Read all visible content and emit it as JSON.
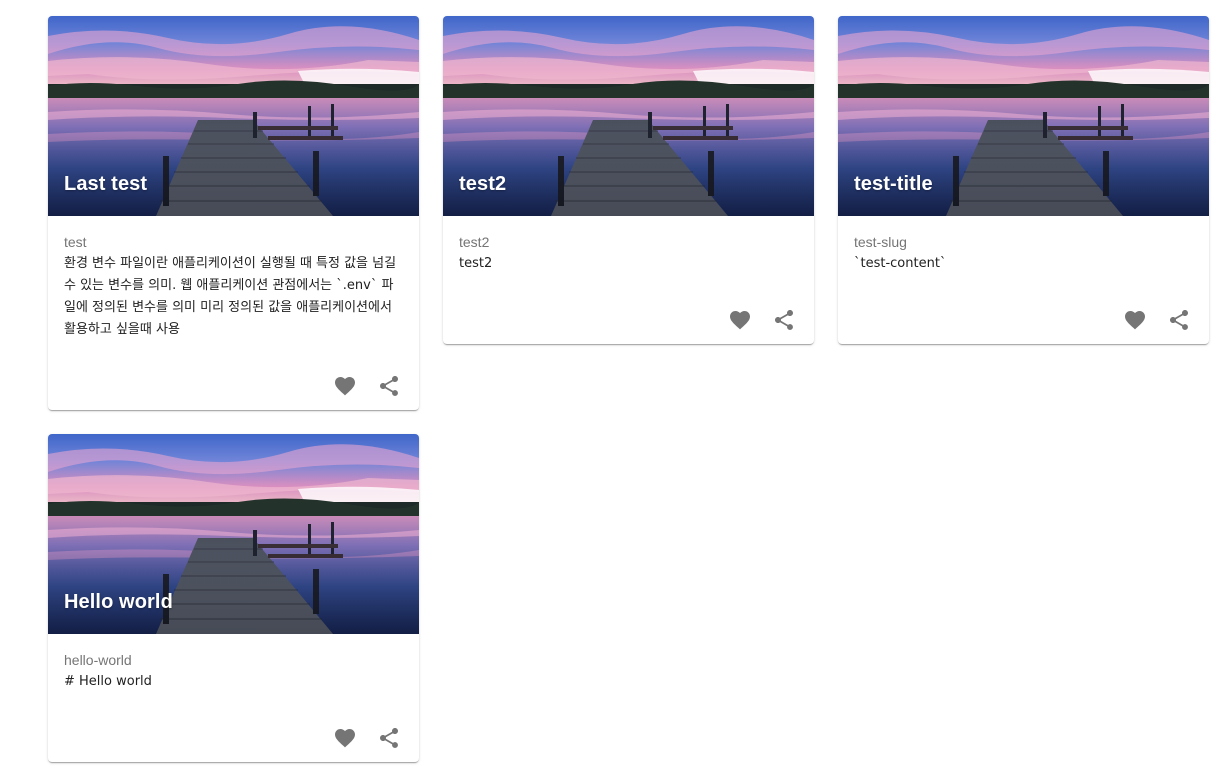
{
  "cards": [
    {
      "title": "Last test",
      "subtitle": "test",
      "content": "환경 변수 파일이란 애플리케이션이 실행될 때 특정 값을 넘길 수 있는 변수를 의미. 웹 애플리케이션 관점에서는 `.env` 파일에 정의된 변수를 의미 미리 정의된 값을 애플리케이션에서 활용하고 싶을때 사용"
    },
    {
      "title": "test2",
      "subtitle": "test2",
      "content": "test2"
    },
    {
      "title": "test-title",
      "subtitle": "test-slug",
      "content": "`test-content`"
    },
    {
      "title": "Hello world",
      "subtitle": "hello-world",
      "content": "# Hello world"
    }
  ],
  "icons": {
    "favorite": "heart-icon",
    "share": "share-icon"
  },
  "colors": {
    "icon": "#757575",
    "subtitle": "#757575",
    "text": "#212121"
  }
}
